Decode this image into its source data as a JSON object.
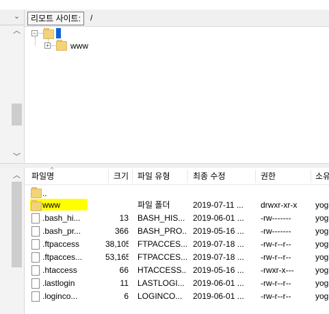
{
  "remote": {
    "label": "리모트 사이트:",
    "path": "/"
  },
  "tree": {
    "root_expander": "⊟",
    "child_expander": "⊞",
    "child_label": "www"
  },
  "list": {
    "headers": {
      "name": "파일명",
      "size": "크기",
      "type": "파일 유형",
      "modified": "최종 수정",
      "perms": "권한",
      "owner": "소유"
    },
    "rows": [
      {
        "name": "..",
        "size": "",
        "type": "",
        "modified": "",
        "perms": "",
        "owner": "",
        "icon": "folder"
      },
      {
        "name": "www",
        "size": "",
        "type": "파일 폴더",
        "modified": "2019-07-11 ...",
        "perms": "drwxr-xr-x",
        "owner": "yog",
        "icon": "folder"
      },
      {
        "name": ".bash_hi...",
        "size": "13",
        "type": "BASH_HIS...",
        "modified": "2019-06-01 ...",
        "perms": "-rw-------",
        "owner": "yog",
        "icon": "file"
      },
      {
        "name": ".bash_pr...",
        "size": "366",
        "type": "BASH_PRO...",
        "modified": "2019-05-16 ...",
        "perms": "-rw-------",
        "owner": "yog",
        "icon": "file"
      },
      {
        "name": ".ftpaccess",
        "size": "38,105",
        "type": "FTPACCES...",
        "modified": "2019-07-18 ...",
        "perms": "-rw-r--r--",
        "owner": "yog",
        "icon": "file"
      },
      {
        "name": ".ftpacces...",
        "size": "53,165",
        "type": "FTPACCES...",
        "modified": "2019-07-18 ...",
        "perms": "-rw-r--r--",
        "owner": "yog",
        "icon": "file"
      },
      {
        "name": ".htaccess",
        "size": "66",
        "type": "HTACCESS...",
        "modified": "2019-05-16 ...",
        "perms": "-rwxr-x---",
        "owner": "yog",
        "icon": "file"
      },
      {
        "name": ".lastlogin",
        "size": "11",
        "type": "LASTLOGI...",
        "modified": "2019-06-01 ...",
        "perms": "-rw-r--r--",
        "owner": "yog",
        "icon": "file"
      },
      {
        "name": ".loginco...",
        "size": "6",
        "type": "LOGINCO...",
        "modified": "2019-06-01 ...",
        "perms": "-rw-r--r--",
        "owner": "yog",
        "icon": "file"
      }
    ]
  },
  "icons": {
    "scroll_up": "chevron-up-icon",
    "scroll_down": "chevron-down-icon",
    "folder": "folder-icon",
    "file": "file-icon"
  },
  "colors": {
    "highlight": "#ffff00",
    "selection": "#0a64d8",
    "folder": "#f3d27a"
  }
}
